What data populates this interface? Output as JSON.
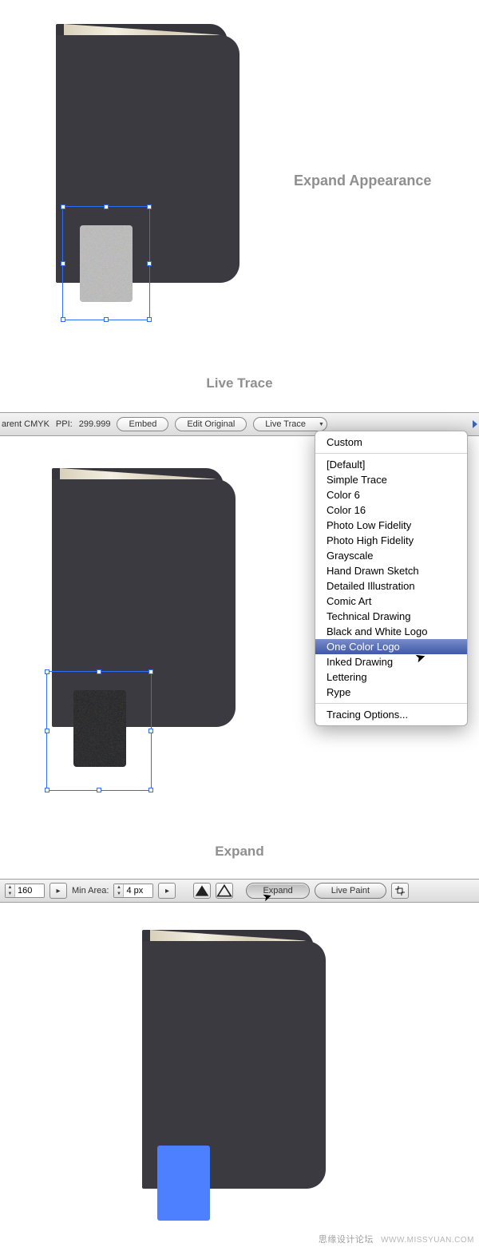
{
  "section1": {
    "title": "Expand Appearance"
  },
  "section2": {
    "title": "Live Trace",
    "toolbar": {
      "profile_label": "arent CMYK",
      "ppi_label": "PPI:",
      "ppi_value": "299.999",
      "btn_embed": "Embed",
      "btn_edit_original": "Edit Original",
      "btn_live_trace": "Live Trace"
    },
    "popup": {
      "top": "Custom",
      "items": [
        "[Default]",
        "Simple Trace",
        "Color 6",
        "Color 16",
        "Photo Low Fidelity",
        "Photo High Fidelity",
        "Grayscale",
        "Hand Drawn Sketch",
        "Detailed Illustration",
        "Comic Art",
        "Technical Drawing",
        "Black and White Logo",
        "One Color Logo",
        "Inked Drawing",
        "Lettering",
        "Rype"
      ],
      "footer": "Tracing Options...",
      "selected_index": 12
    }
  },
  "section3": {
    "title": "Expand",
    "toolbar": {
      "threshold_value": "160",
      "minarea_label": "Min Area:",
      "minarea_value": "4 px",
      "btn_expand": "Expand",
      "btn_live_paint": "Live Paint"
    }
  },
  "watermark": {
    "cn": "思缘设计论坛",
    "url": "WWW.MISSYUAN.COM"
  }
}
